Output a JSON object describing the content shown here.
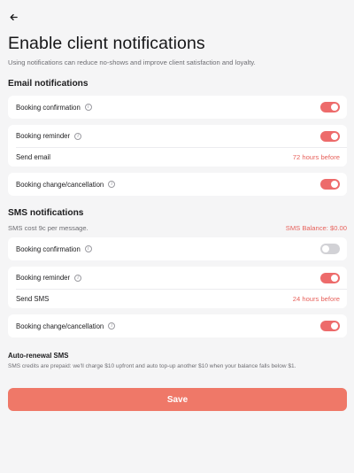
{
  "header": {
    "title": "Enable client notifications",
    "subtitle": "Using notifications can reduce no-shows and improve client satisfaction and loyalty."
  },
  "email": {
    "section_title": "Email notifications",
    "confirmation": {
      "label": "Booking confirmation",
      "enabled": true
    },
    "reminder": {
      "label": "Booking reminder",
      "enabled": true,
      "send_label": "Send email",
      "send_value": "72 hours before"
    },
    "change": {
      "label": "Booking change/cancellation",
      "enabled": true
    }
  },
  "sms": {
    "section_title": "SMS notifications",
    "cost_text": "SMS cost 9c per message.",
    "balance_text": "SMS Balance: $0.00",
    "confirmation": {
      "label": "Booking confirmation",
      "enabled": false
    },
    "reminder": {
      "label": "Booking reminder",
      "enabled": true,
      "send_label": "Send SMS",
      "send_value": "24 hours before"
    },
    "change": {
      "label": "Booking change/cancellation",
      "enabled": true
    }
  },
  "auto_renewal": {
    "title": "Auto-renewal SMS",
    "text": "SMS credits are prepaid: we'll charge $10 upfront and auto top-up another $10 when your balance falls below $1."
  },
  "save_label": "Save",
  "icons": {
    "back": "arrow-left-icon",
    "info": "info-icon"
  },
  "colors": {
    "accent": "#ed6b6b",
    "save_button": "#ef7868",
    "link": "#e7625c"
  }
}
